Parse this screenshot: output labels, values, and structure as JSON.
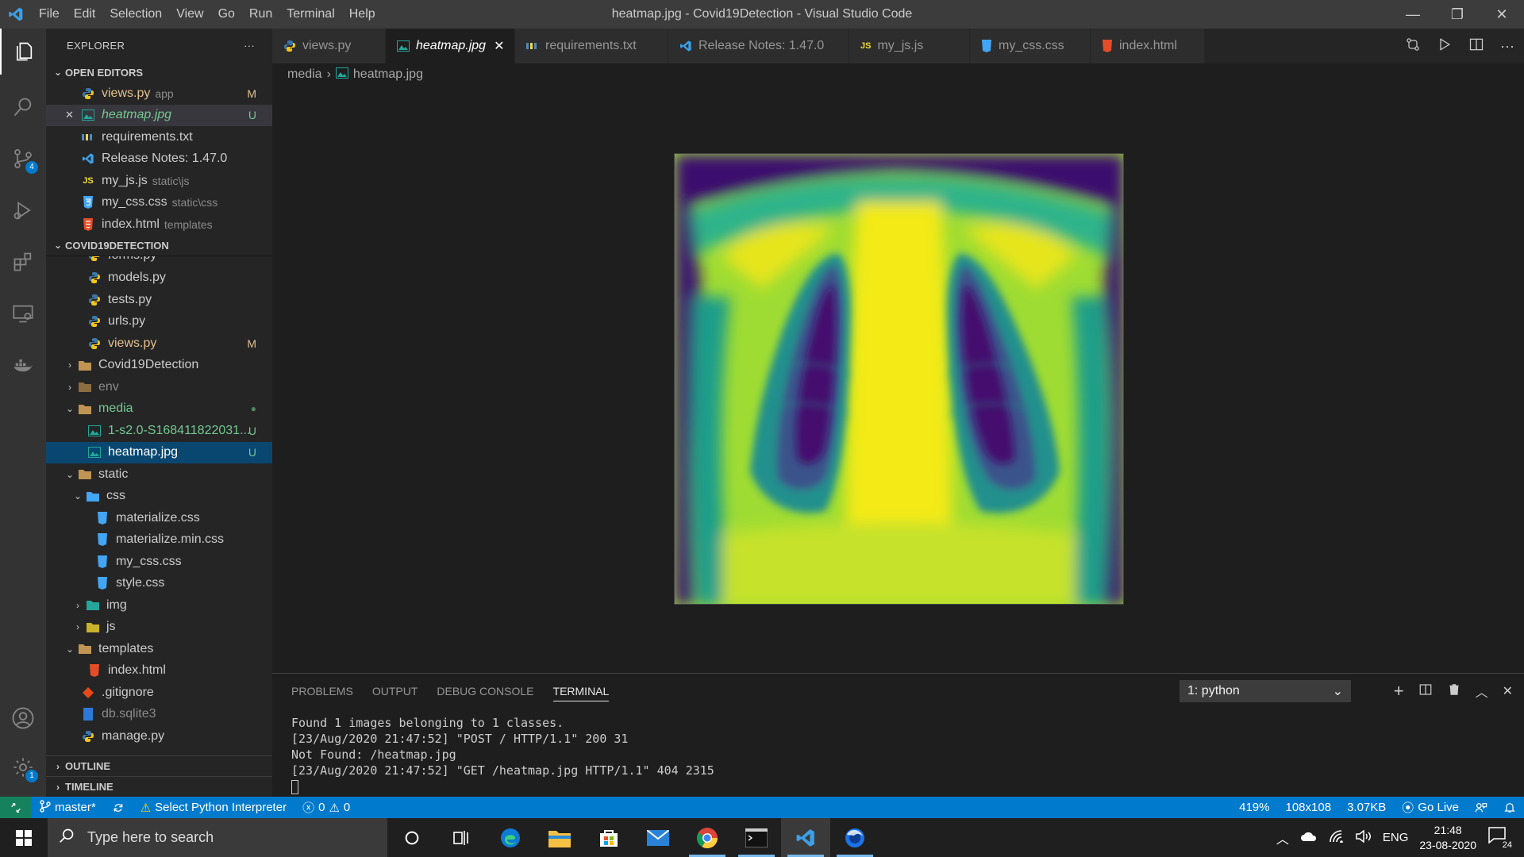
{
  "window": {
    "title": "heatmap.jpg - Covid19Detection - Visual Studio Code",
    "menu": [
      "File",
      "Edit",
      "Selection",
      "View",
      "Go",
      "Run",
      "Terminal",
      "Help"
    ]
  },
  "activitybar": {
    "scm_badge": "4",
    "settings_badge": "1"
  },
  "sidebar": {
    "header": "EXPLORER",
    "open_editors_title": "OPEN EDITORS",
    "open_editors": [
      {
        "name": "views.py",
        "desc": "app",
        "status": "M"
      },
      {
        "name": "heatmap.jpg",
        "desc": "",
        "status": "U"
      },
      {
        "name": "requirements.txt",
        "desc": "",
        "status": ""
      },
      {
        "name": "Release Notes: 1.47.0",
        "desc": "",
        "status": ""
      },
      {
        "name": "my_js.js",
        "desc": "static\\js",
        "status": ""
      },
      {
        "name": "my_css.css",
        "desc": "static\\css",
        "status": ""
      },
      {
        "name": "index.html",
        "desc": "templates",
        "status": ""
      }
    ],
    "project_title": "COVID19DETECTION",
    "tree": [
      {
        "name": "forms.py"
      },
      {
        "name": "models.py"
      },
      {
        "name": "tests.py"
      },
      {
        "name": "urls.py"
      },
      {
        "name": "views.py",
        "status": "M"
      },
      {
        "name": "Covid19Detection"
      },
      {
        "name": "env"
      },
      {
        "name": "media"
      },
      {
        "name": "1-s2.0-S168411822031...",
        "status": "U"
      },
      {
        "name": "heatmap.jpg",
        "status": "U"
      },
      {
        "name": "static"
      },
      {
        "name": "css"
      },
      {
        "name": "materialize.css"
      },
      {
        "name": "materialize.min.css"
      },
      {
        "name": "my_css.css"
      },
      {
        "name": "style.css"
      },
      {
        "name": "img"
      },
      {
        "name": "js"
      },
      {
        "name": "templates"
      },
      {
        "name": "index.html"
      },
      {
        "name": ".gitignore"
      },
      {
        "name": "db.sqlite3"
      },
      {
        "name": "manage.py"
      }
    ],
    "outline_title": "OUTLINE",
    "timeline_title": "TIMELINE"
  },
  "tabs": [
    {
      "label": "views.py"
    },
    {
      "label": "heatmap.jpg"
    },
    {
      "label": "requirements.txt"
    },
    {
      "label": "Release Notes: 1.47.0"
    },
    {
      "label": "my_js.js"
    },
    {
      "label": "my_css.css"
    },
    {
      "label": "index.html"
    }
  ],
  "breadcrumb": {
    "folder": "media",
    "file": "heatmap.jpg"
  },
  "panel": {
    "tabs": [
      "PROBLEMS",
      "OUTPUT",
      "DEBUG CONSOLE",
      "TERMINAL"
    ],
    "terminal_select": "1: python",
    "terminal_lines": [
      "Found 1 images belonging to 1 classes.",
      "[23/Aug/2020 21:47:52] \"POST / HTTP/1.1\" 200 31",
      "Not Found: /heatmap.jpg",
      "[23/Aug/2020 21:47:52] \"GET /heatmap.jpg HTTP/1.1\" 404 2315"
    ]
  },
  "statusbar": {
    "branch": "master*",
    "interpreter": "Select Python Interpreter",
    "errors": "0",
    "warnings": "0",
    "zoom": "419%",
    "dimensions": "108x108",
    "filesize": "3.07KB",
    "golive": "Go Live"
  },
  "taskbar": {
    "search_placeholder": "Type here to search",
    "lang": "ENG",
    "time": "21:48",
    "date": "23-08-2020",
    "notif_count": "24"
  }
}
